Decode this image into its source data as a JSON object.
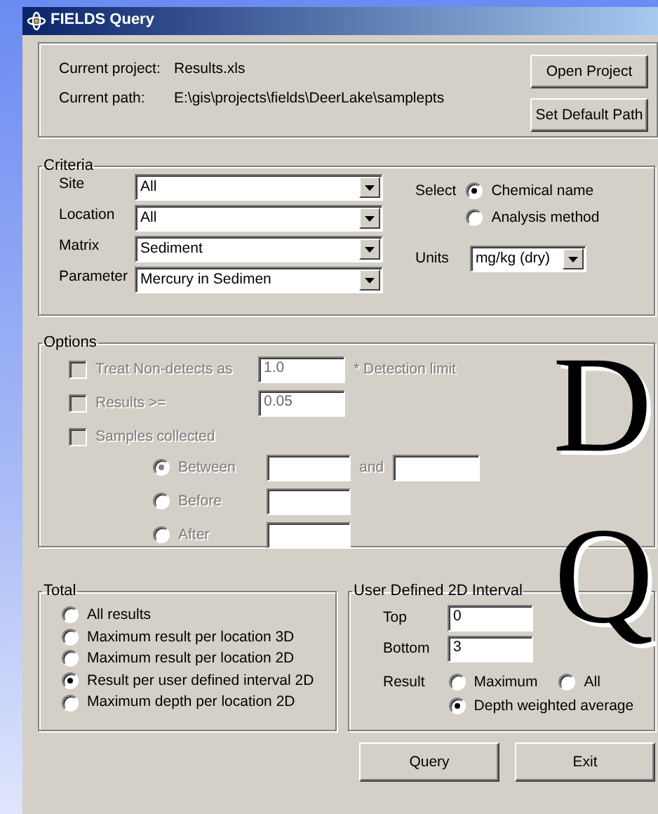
{
  "window": {
    "title": "FIELDS Query"
  },
  "project": {
    "fields": [
      {
        "label": "Current project:",
        "value": "Results.xls"
      },
      {
        "label": "Current path:",
        "value": "E:\\gis\\projects\\fields\\DeerLake\\samplepts"
      }
    ],
    "buttons": [
      "Open Project",
      "Set Default Path"
    ]
  },
  "criteria": {
    "title": "Criteria",
    "dropdowns": [
      {
        "label": "Site",
        "value": "All"
      },
      {
        "label": "Location",
        "value": "All"
      },
      {
        "label": "Matrix",
        "value": "Sediment"
      },
      {
        "label": "Parameter",
        "value": "Mercury in Sedimen"
      }
    ],
    "select": {
      "label": "Select",
      "options": [
        {
          "label": "Chemical name",
          "selected": true
        },
        {
          "label": "Analysis method",
          "selected": false
        }
      ]
    },
    "units": {
      "label": "Units",
      "value": "mg/kg (dry)"
    }
  },
  "options": {
    "title": "Options",
    "disabled": true,
    "checks": [
      {
        "label": "Treat Non-detects as",
        "checked": false,
        "value": "1.0",
        "suffix": "* Detection limit"
      },
      {
        "label": "Results >=",
        "checked": false,
        "value": "0.05"
      },
      {
        "label": "Samples collected",
        "checked": false
      }
    ],
    "date_options": [
      {
        "label": "Between",
        "selected": true,
        "joiner": "and"
      },
      {
        "label": "Before",
        "selected": false
      },
      {
        "label": "After",
        "selected": false
      }
    ]
  },
  "total": {
    "title": "Total",
    "options": [
      {
        "label": "All results",
        "selected": false
      },
      {
        "label": "Maximum result per location 3D",
        "selected": false
      },
      {
        "label": "Maximum result per location 2D",
        "selected": false
      },
      {
        "label": "Result per user defined interval 2D",
        "selected": true
      },
      {
        "label": "Maximum depth per location 2D",
        "selected": false
      }
    ]
  },
  "interval": {
    "title": "User Defined 2D Interval",
    "fields": [
      {
        "label": "Top",
        "value": "0"
      },
      {
        "label": "Bottom",
        "value": "3"
      }
    ],
    "result": {
      "label": "Result",
      "options": [
        {
          "label": "Maximum",
          "selected": false
        },
        {
          "label": "All",
          "selected": false
        },
        {
          "label": "Depth weighted average",
          "selected": true
        }
      ]
    }
  },
  "buttons": [
    "Query",
    "Exit"
  ],
  "backdrop_letters": [
    "D",
    "Q"
  ]
}
